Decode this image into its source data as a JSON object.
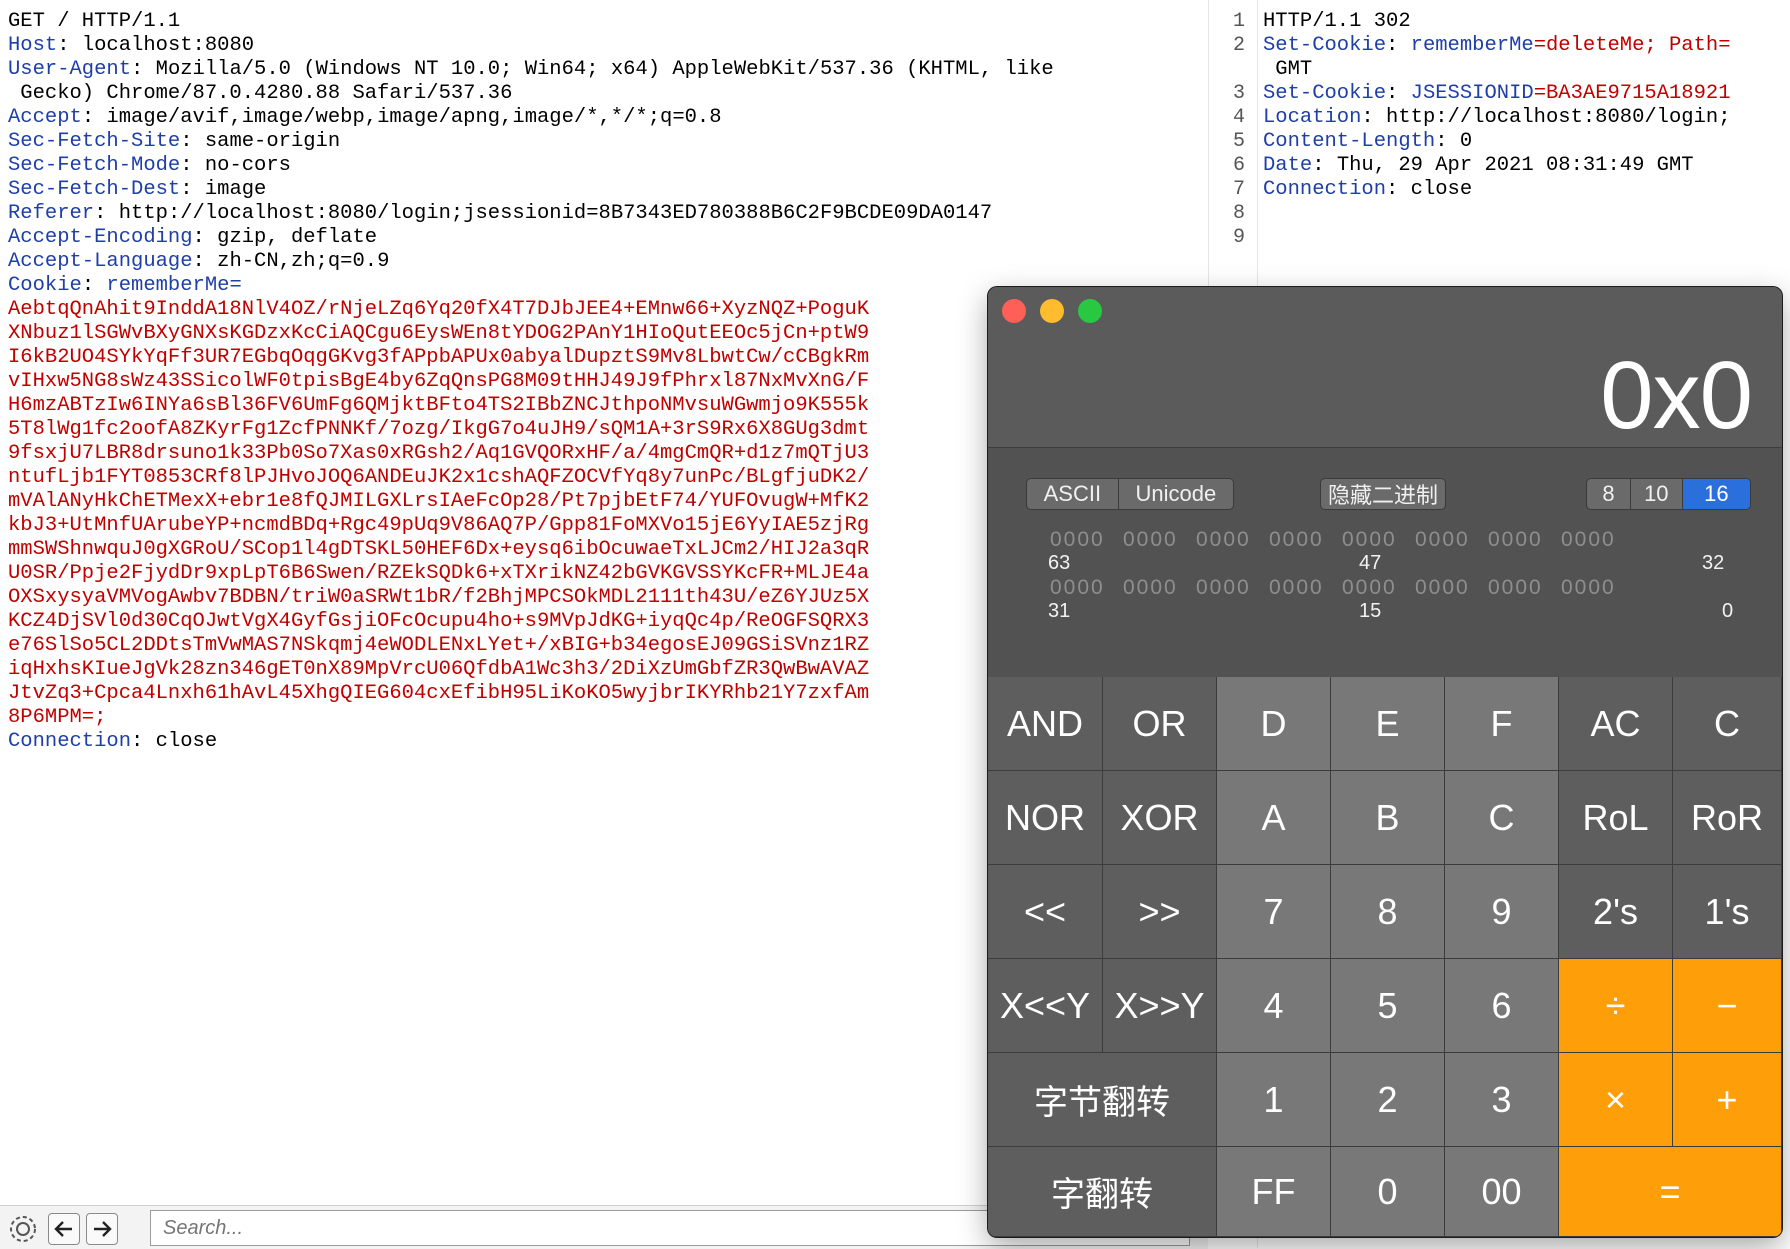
{
  "request": {
    "request_line": "GET / HTTP/1.1",
    "headers": [
      {
        "name": "Host",
        "value": "localhost:8080"
      },
      {
        "name": "User-Agent",
        "value": "Mozilla/5.0 (Windows NT 10.0; Win64; x64) AppleWebKit/537.36 (KHTML, like"
      },
      {
        "name": "",
        "value": " Gecko) Chrome/87.0.4280.88 Safari/537.36"
      },
      {
        "name": "Accept",
        "value": "image/avif,image/webp,image/apng,image/*,*/*;q=0.8"
      },
      {
        "name": "Sec-Fetch-Site",
        "value": "same-origin"
      },
      {
        "name": "Sec-Fetch-Mode",
        "value": "no-cors"
      },
      {
        "name": "Sec-Fetch-Dest",
        "value": "image"
      },
      {
        "name": "Referer",
        "value": "http://localhost:8080/login;jsessionid=8B7343ED780388B6C2F9BCDE09DA0147"
      },
      {
        "name": "Accept-Encoding",
        "value": "gzip, deflate"
      },
      {
        "name": "Accept-Language",
        "value": "zh-CN,zh;q=0.9"
      }
    ],
    "cookie_label": "Cookie",
    "cookie_name": "rememberMe=",
    "cookie_value_lines": [
      "AebtqQnAhit9InddA18NlV4OZ/rNjeLZq6Yq20fX4T7DJbJEE4+EMnw66+XyzNQZ+PoguK",
      "XNbuz1lSGWvBXyGNXsKGDzxKcCiAQCgu6EysWEn8tYDOG2PAnY1HIoQutEEOc5jCn+ptW9",
      "I6kB2UO4SYkYqFf3UR7EGbqOqgGKvg3fAPpbAPUx0abyalDupztS9Mv8LbwtCw/cCBgkRm",
      "vIHxw5NG8sWz43SSicolWF0tpisBgE4by6ZqQnsPG8M09tHHJ49J9fPhrxl87NxMvXnG/F",
      "H6mzABTzIw6INYa6sBl36FV6UmFg6QMjktBFto4TS2IBbZNCJthpoNMvsuWGwmjo9K555k",
      "5T8lWg1fc2oofA8ZKyrFg1ZcfPNNKf/7ozg/IkgG7o4uJH9/sQM1A+3rS9Rx6X8GUg3dmt",
      "9fsxjU7LBR8drsuno1k33Pb0So7Xas0xRGsh2/Aq1GVQORxHF/a/4mgCmQR+d1z7mQTjU3",
      "ntufLjb1FYT0853CRf8lPJHvoJOQ6ANDEuJK2x1cshAQFZOCVfYq8y7unPc/BLgfjuDK2/",
      "mVAlANyHkChETMexX+ebr1e8fQJMILGXLrsIAeFcOp28/Pt7pjbEtF74/YUFOvugW+MfK2",
      "kbJ3+UtMnfUArubeYP+ncmdBDq+Rgc49pUq9V86AQ7P/Gpp81FoMXVo15jE6YyIAE5zjRg",
      "mmSWShnwquJ0gXGRoU/SCop1l4gDTSKL50HEF6Dx+eysq6ibOcuwaeTxLJCm2/HIJ2a3qR",
      "U0SR/Ppje2FjydDr9xpLpT6B6Swen/RZEkSQDk6+xTXrikNZ42bGVKGVSSYKcFR+MLJE4a",
      "OXSxysyaVMVogAwbv7BDBN/triW0aSRWt1bR/f2BhjMPCSOkMDL2111th43U/eZ6YJUz5X",
      "KCZ4DjSVl0d30CqOJwtVgX4GyfGsjiOFcOcupu4ho+s9MVpJdKG+iyqQc4p/ReOGFSQRX3",
      "e76SlSo5CL2DDtsTmVwMAS7NSkqmj4eWODLENxLYet+/xBIG+b34egosEJ09GSiSVnz1RZ",
      "iqHxhsKIueJgVk28zn346gET0nX89MpVrcU06QfdbA1Wc3h3/2DiXzUmGbfZR3QwBwAVAZ",
      "JtvZq3+Cpca4Lnxh61hAvL45XhgQIEG604cxEfibH95LiKoKO5wyjbrIKYRhb21Y7zxfAm",
      "8P6MPM=;"
    ],
    "connection_label": "Connection",
    "connection_value": "close"
  },
  "bottom_bar": {
    "search_placeholder": "Search..."
  },
  "response": {
    "line_numbers": [
      "1",
      "2",
      "3",
      "4",
      "5",
      "6",
      "7",
      "8",
      "9"
    ],
    "status_line": "HTTP/1.1 302",
    "lines": [
      {
        "num": "2",
        "name": "Set-Cookie",
        "key": "rememberMe",
        "value": "=deleteMe; Path="
      },
      {
        "num": "",
        "name": "",
        "key": "",
        "value": " GMT"
      },
      {
        "num": "3",
        "name": "Set-Cookie",
        "key": "JSESSIONID",
        "value": "=BA3AE9715A18921"
      },
      {
        "num": "4",
        "name": "Location",
        "key": "",
        "value": " http://localhost:8080/login;"
      },
      {
        "num": "5",
        "name": "Content-Length",
        "key": "",
        "value": " 0"
      },
      {
        "num": "6",
        "name": "Date",
        "key": "",
        "value": " Thu, 29 Apr 2021 08:31:49 GMT"
      },
      {
        "num": "7",
        "name": "Connection",
        "key": "",
        "value": " close"
      }
    ]
  },
  "calculator": {
    "display": "0x0",
    "encoding_tabs": [
      "ASCII",
      "Unicode"
    ],
    "hide_binary_label": "隐藏二进制",
    "base_tabs": [
      "8",
      "10",
      "16"
    ],
    "selected_base": "16",
    "bit_group": "0000",
    "bit_labels_row1": [
      "63",
      "47",
      "32"
    ],
    "bit_labels_row2": [
      "31",
      "15",
      "0"
    ],
    "keys": {
      "and": "AND",
      "or": "OR",
      "d": "D",
      "e": "E",
      "f": "F",
      "ac": "AC",
      "c_clear": "C",
      "nor": "NOR",
      "xor": "XOR",
      "a": "A",
      "b": "B",
      "c_hex": "C",
      "rol": "RoL",
      "ror": "RoR",
      "shl": "<<",
      "shr": ">>",
      "k7": "7",
      "k8": "8",
      "k9": "9",
      "twos": "2's",
      "ones": "1's",
      "xshly": "X<<Y",
      "xshry": "X>>Y",
      "k4": "4",
      "k5": "5",
      "k6": "6",
      "div": "÷",
      "minus": "−",
      "byte_flip": "字节翻转",
      "k1": "1",
      "k2": "2",
      "k3": "3",
      "mul": "×",
      "plus": "+",
      "word_flip": "字翻转",
      "ff": "FF",
      "k0": "0",
      "k00": "00",
      "eq": "="
    },
    "colors": {
      "operator": "#fe9f0a",
      "base_selected": "#2a6fdc",
      "close": "#fe5f57",
      "minimize": "#febc2e",
      "zoom": "#28c840"
    }
  }
}
